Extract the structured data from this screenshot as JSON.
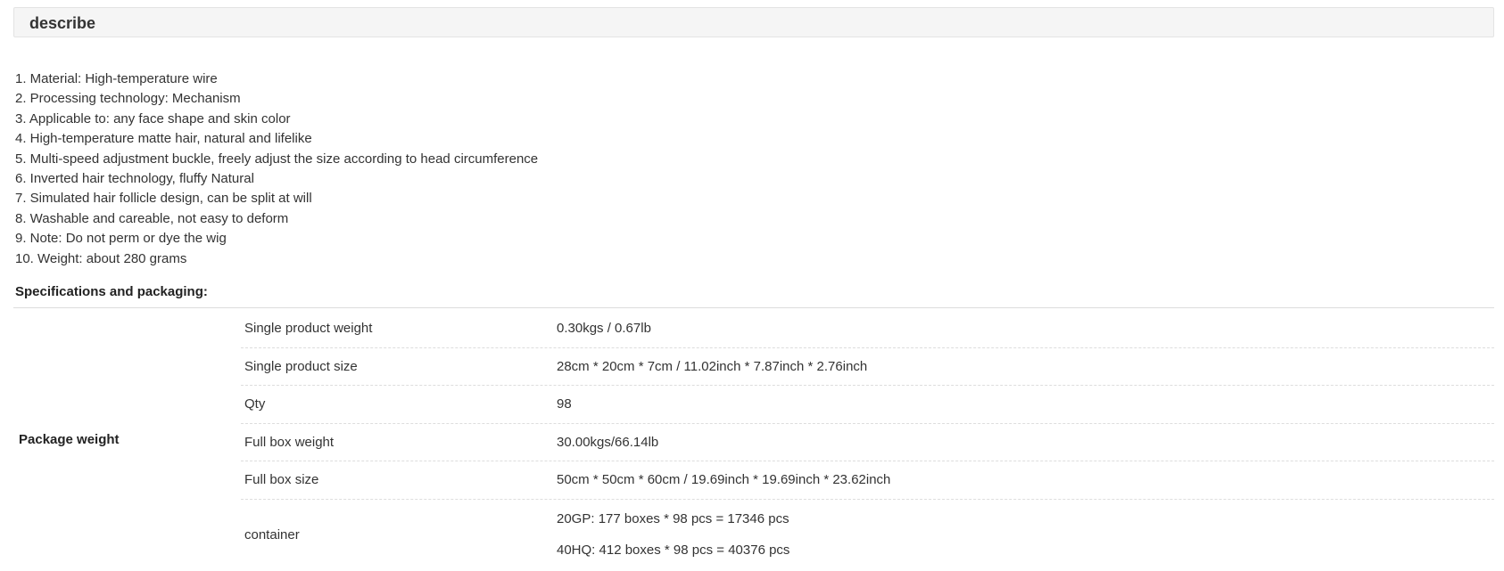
{
  "header": {
    "title": "describe"
  },
  "description": {
    "items": [
      "1. Material: High-temperature wire",
      "2. Processing technology: Mechanism",
      "3. Applicable to: any face shape and skin color",
      "4. High-temperature matte hair, natural and lifelike",
      "5. Multi-speed adjustment buckle, freely adjust the size according to head circumference",
      "6. Inverted hair technology, fluffy Natural",
      "7. Simulated hair follicle design, can be split at will",
      "8. Washable and careable, not easy to deform",
      "9. Note: Do not perm or dye the wig",
      "10. Weight: about 280 grams"
    ]
  },
  "specs": {
    "heading": "Specifications and packaging:",
    "group_label": "Package weight",
    "rows": [
      {
        "name": "Single product weight",
        "value": "0.30kgs / 0.67lb"
      },
      {
        "name": "Single product size",
        "value": "28cm * 20cm * 7cm / 11.02inch * 7.87inch * 2.76inch"
      },
      {
        "name": "Qty",
        "value": "98"
      },
      {
        "name": "Full box weight",
        "value": "30.00kgs/66.14lb"
      },
      {
        "name": "Full box size",
        "value": "50cm * 50cm * 60cm / 19.69inch * 19.69inch * 23.62inch"
      }
    ],
    "container": {
      "name": "container",
      "lines": [
        "20GP: 177 boxes * 98 pcs = 17346 pcs",
        "40HQ: 412 boxes * 98 pcs = 40376 pcs"
      ]
    }
  }
}
